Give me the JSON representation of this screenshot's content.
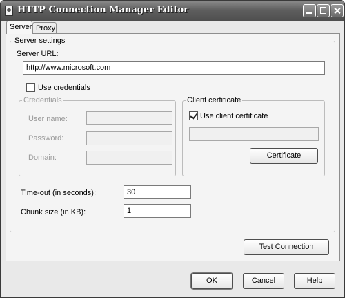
{
  "window": {
    "title": "HTTP Connection Manager Editor"
  },
  "tabs": [
    {
      "label": "Server"
    },
    {
      "label": "Proxy"
    }
  ],
  "server_settings": {
    "legend": "Server settings",
    "server_url_label": "Server URL:",
    "server_url_value": "http://www.microsoft.com",
    "use_credentials_label": "Use credentials",
    "use_credentials_checked": false,
    "credentials": {
      "legend": "Credentials",
      "username_label": "User name:",
      "password_label": "Password:",
      "domain_label": "Domain:"
    },
    "client_certificate": {
      "legend": "Client certificate",
      "use_client_certificate_label": "Use client certificate",
      "use_client_certificate_checked": true,
      "certificate_value": "",
      "certificate_button": "Certificate"
    },
    "timeout_label": "Time-out (in seconds):",
    "timeout_value": "30",
    "chunk_label": "Chunk size (in KB):",
    "chunk_value": "1"
  },
  "test_connection_button": "Test Connection",
  "footer": {
    "ok": "OK",
    "cancel": "Cancel",
    "help": "Help"
  }
}
